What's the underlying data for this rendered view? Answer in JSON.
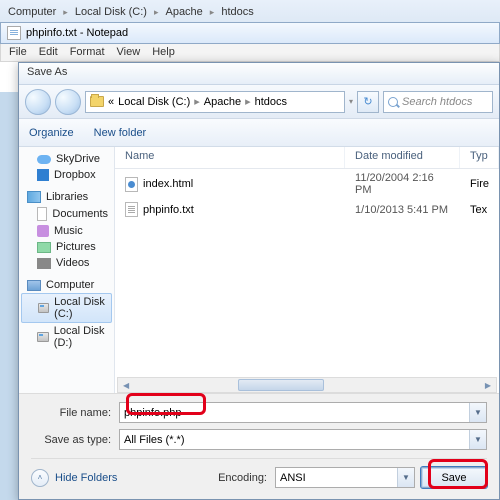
{
  "explorer": {
    "crumbs": [
      "Computer",
      "Local Disk (C:)",
      "Apache",
      "htdocs"
    ]
  },
  "notepad": {
    "title": "phpinfo.txt - Notepad",
    "menu": [
      "File",
      "Edit",
      "Format",
      "View",
      "Help"
    ]
  },
  "saveas": {
    "title": "Save As",
    "addr_prefix": "«",
    "crumbs": [
      "Local Disk (C:)",
      "Apache",
      "htdocs"
    ],
    "search_placeholder": "Search htdocs",
    "organize": "Organize",
    "newfolder": "New folder",
    "sidebar": {
      "skydrive": "SkyDrive",
      "dropbox": "Dropbox",
      "libraries": "Libraries",
      "documents": "Documents",
      "music": "Music",
      "pictures": "Pictures",
      "videos": "Videos",
      "computer": "Computer",
      "localc": "Local Disk (C:)",
      "locald": "Local Disk (D:)"
    },
    "columns": {
      "name": "Name",
      "date": "Date modified",
      "type": "Typ"
    },
    "files": [
      {
        "name": "index.html",
        "date": "11/20/2004 2:16 PM",
        "type": "Fire"
      },
      {
        "name": "phpinfo.txt",
        "date": "1/10/2013 5:41 PM",
        "type": "Tex"
      }
    ],
    "filename_label": "File name:",
    "filename_value": "phpinfo.php",
    "savetype_label": "Save as type:",
    "savetype_value": "All Files (*.*)",
    "encoding_label": "Encoding:",
    "encoding_value": "ANSI",
    "hide_folders": "Hide Folders",
    "save_btn": "Save"
  }
}
